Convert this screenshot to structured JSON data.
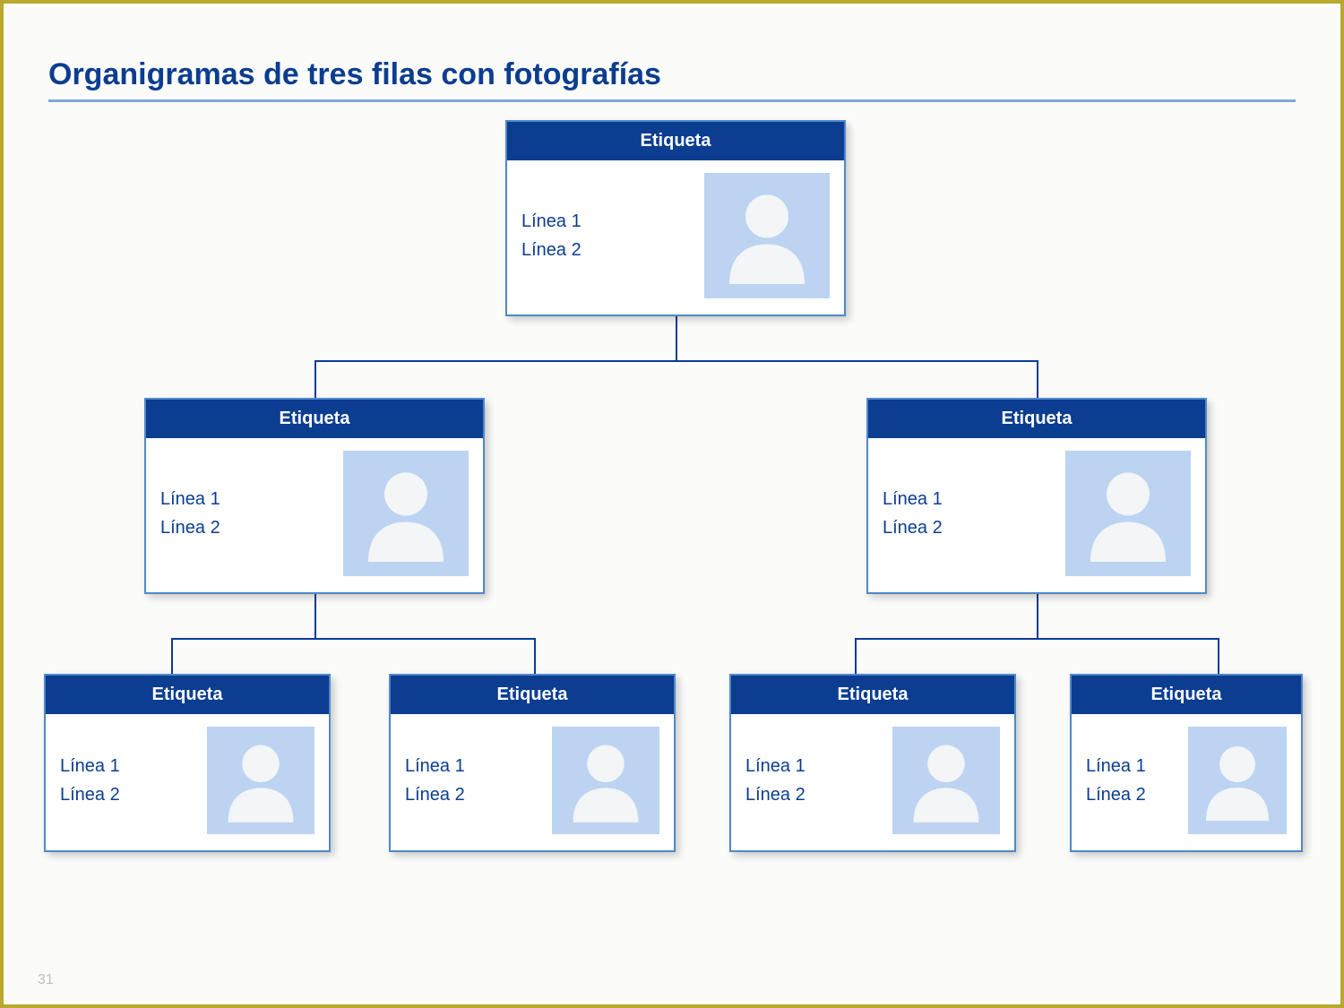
{
  "title": "Organigramas de tres filas con fotografías",
  "page_number": "31",
  "cards": {
    "root": {
      "label": "Etiqueta",
      "line1": "Línea 1",
      "line2": "Línea 2"
    },
    "mid_l": {
      "label": "Etiqueta",
      "line1": "Línea 1",
      "line2": "Línea 2"
    },
    "mid_r": {
      "label": "Etiqueta",
      "line1": "Línea 1",
      "line2": "Línea 2"
    },
    "leaf_1": {
      "label": "Etiqueta",
      "line1": "Línea 1",
      "line2": "Línea 2"
    },
    "leaf_2": {
      "label": "Etiqueta",
      "line1": "Línea 1",
      "line2": "Línea 2"
    },
    "leaf_3": {
      "label": "Etiqueta",
      "line1": "Línea 1",
      "line2": "Línea 2"
    },
    "leaf_4": {
      "label": "Etiqueta",
      "line1": "Línea 1",
      "line2": "Línea 2"
    }
  }
}
